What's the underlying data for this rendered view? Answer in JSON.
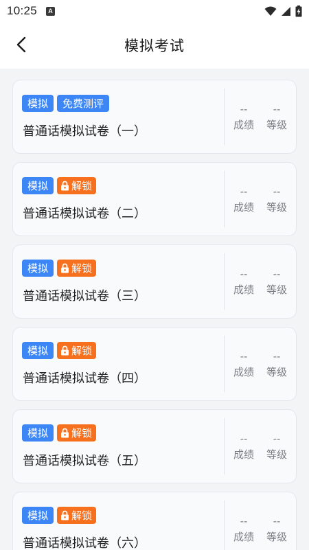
{
  "status": {
    "time": "10:25"
  },
  "header": {
    "title": "模拟考试"
  },
  "cards": [
    {
      "tags": [
        "模拟",
        "免费测评"
      ],
      "locked": false,
      "name": "普通话模拟试卷（一）",
      "score": "--",
      "score_label": "成绩",
      "grade": "--",
      "grade_label": "等级"
    },
    {
      "tags": [
        "模拟"
      ],
      "locked": true,
      "lock_label": "解锁",
      "name": "普通话模拟试卷（二）",
      "score": "--",
      "score_label": "成绩",
      "grade": "--",
      "grade_label": "等级"
    },
    {
      "tags": [
        "模拟"
      ],
      "locked": true,
      "lock_label": "解锁",
      "name": "普通话模拟试卷（三）",
      "score": "--",
      "score_label": "成绩",
      "grade": "--",
      "grade_label": "等级"
    },
    {
      "tags": [
        "模拟"
      ],
      "locked": true,
      "lock_label": "解锁",
      "name": "普通话模拟试卷（四）",
      "score": "--",
      "score_label": "成绩",
      "grade": "--",
      "grade_label": "等级"
    },
    {
      "tags": [
        "模拟"
      ],
      "locked": true,
      "lock_label": "解锁",
      "name": "普通话模拟试卷（五）",
      "score": "--",
      "score_label": "成绩",
      "grade": "--",
      "grade_label": "等级"
    },
    {
      "tags": [
        "模拟"
      ],
      "locked": true,
      "lock_label": "解锁",
      "name": "普通话模拟试卷（六）",
      "score": "--",
      "score_label": "成绩",
      "grade": "--",
      "grade_label": "等级"
    }
  ],
  "colors": {
    "tag_blue": "#3d86f5",
    "tag_orange": "#f6701e",
    "background": "#f3f4f6"
  },
  "icons": {
    "back": "chevron-left-icon",
    "lock": "lock-icon",
    "wifi": "wifi-icon",
    "signal": "signal-icon",
    "battery": "battery-icon"
  }
}
